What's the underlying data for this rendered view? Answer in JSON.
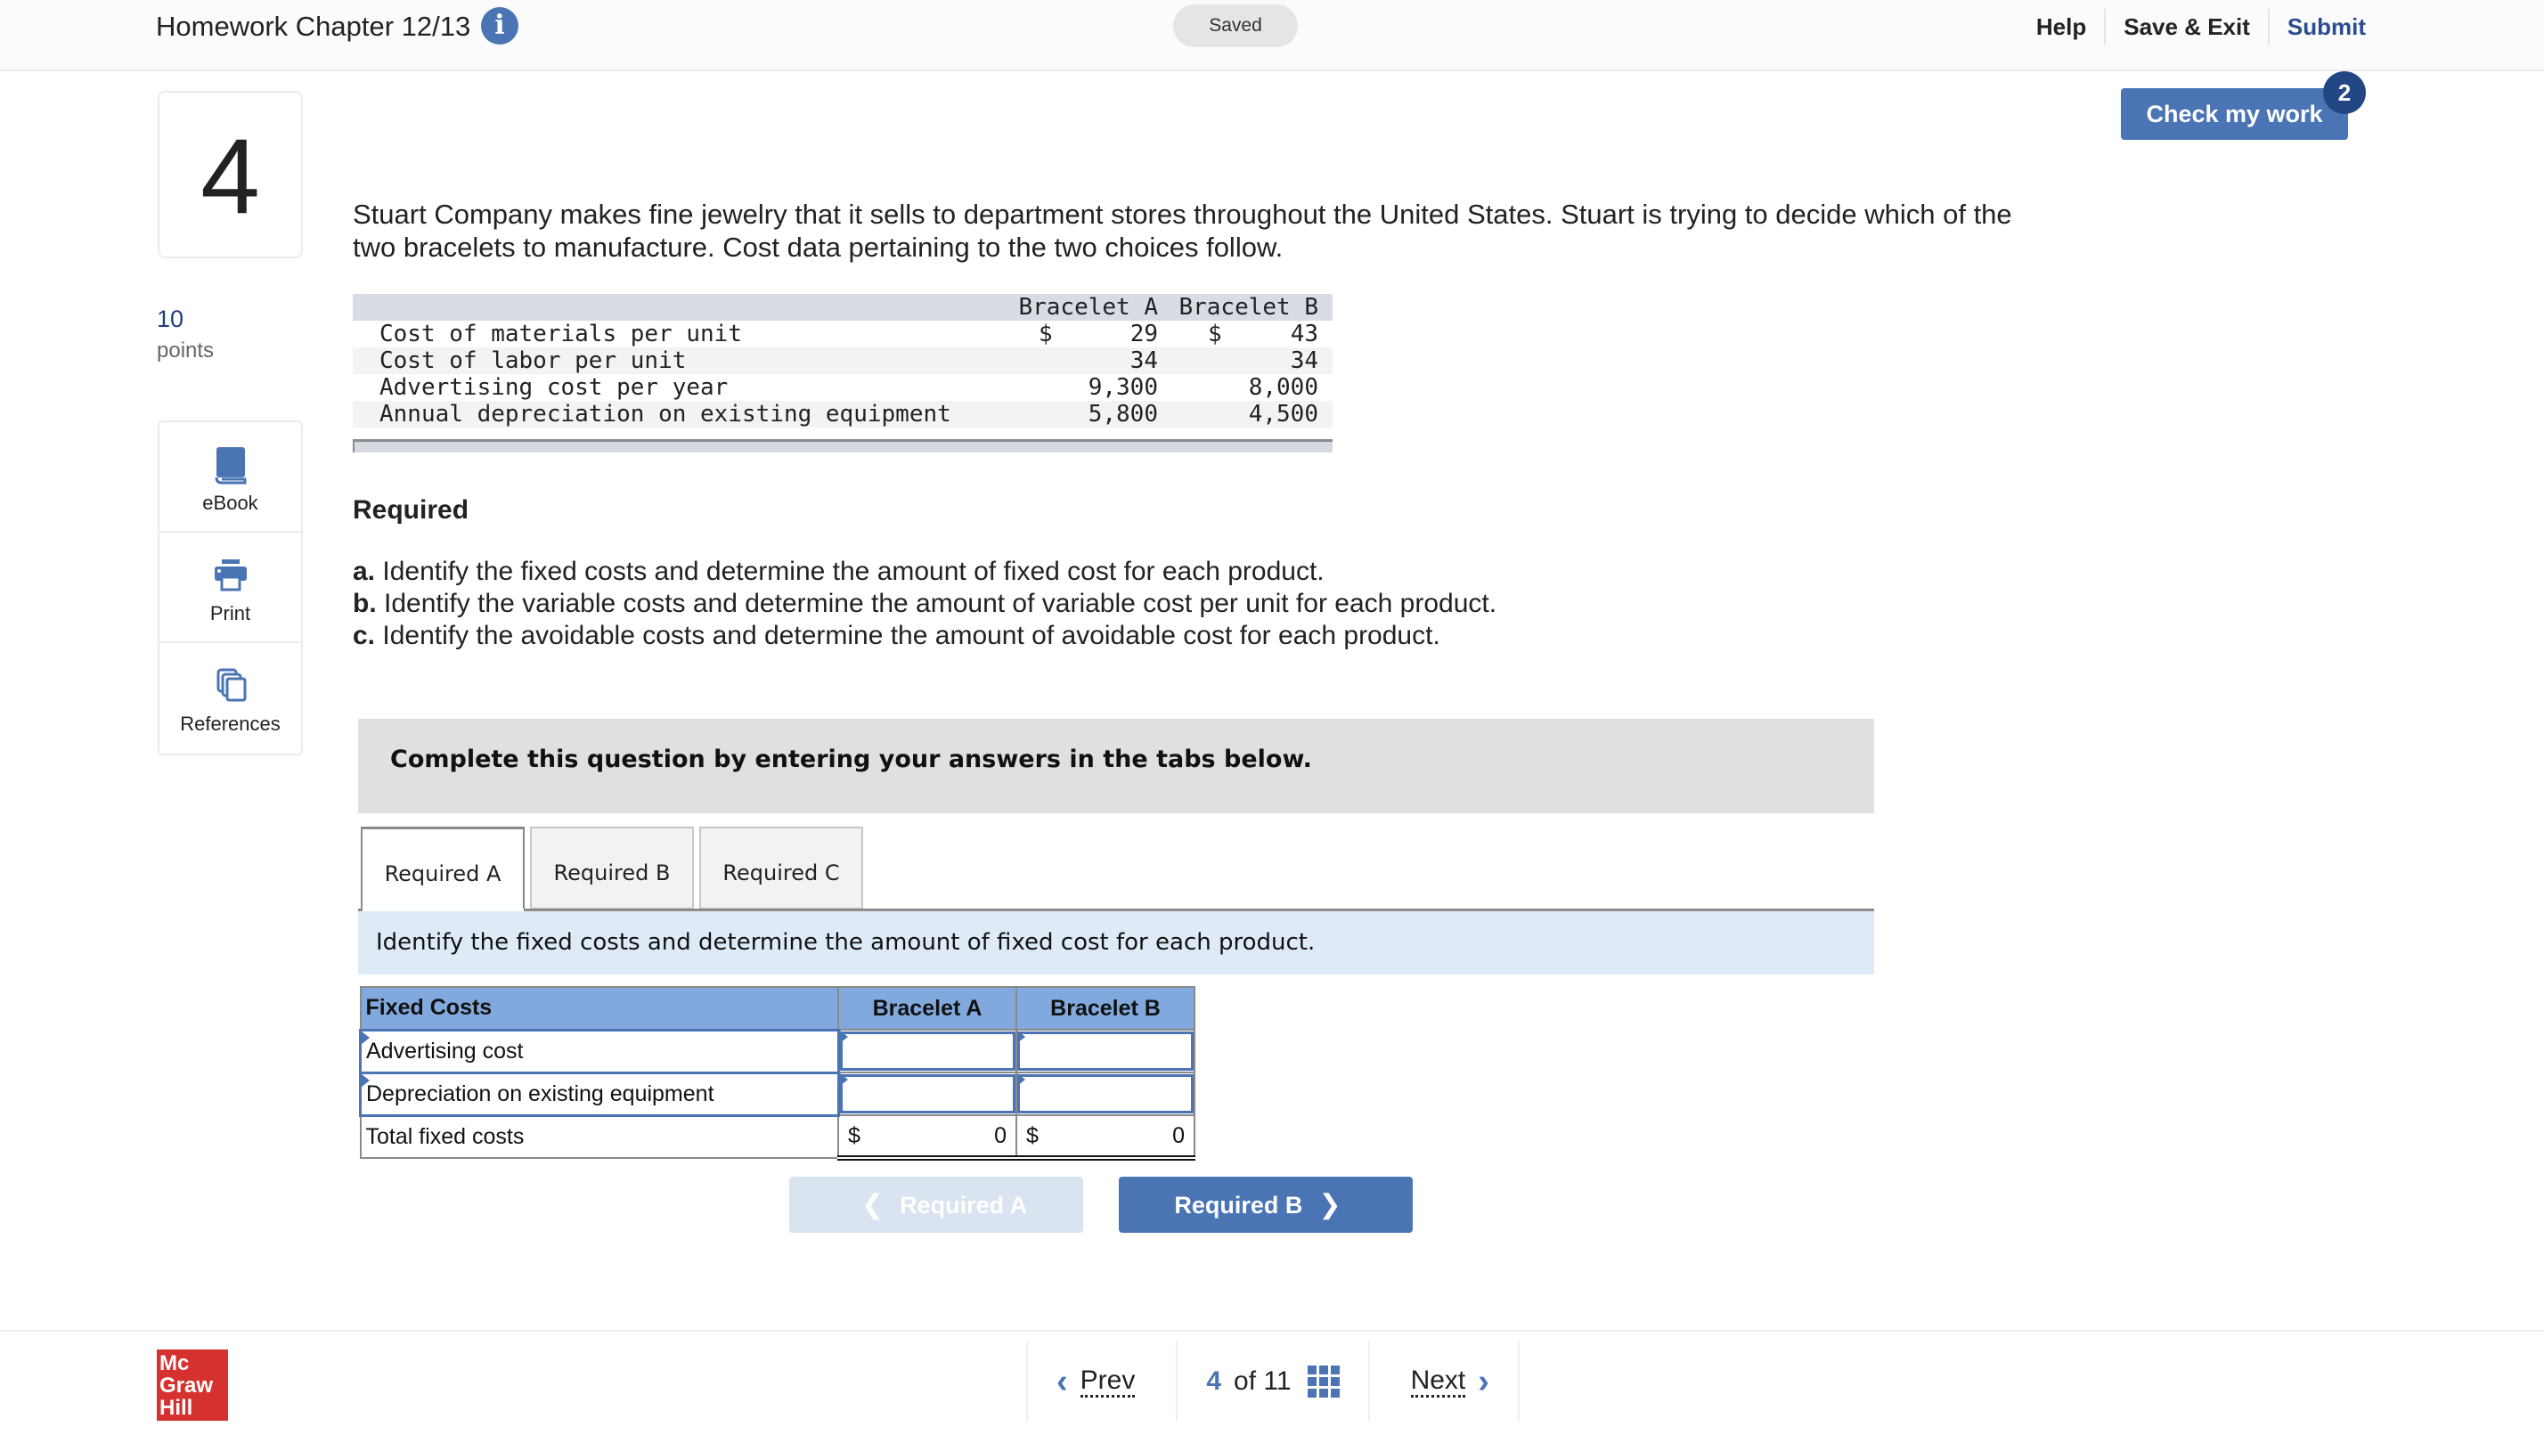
{
  "header": {
    "title": "Homework Chapter 12/13",
    "save_status": "Saved",
    "links": {
      "help": "Help",
      "save_exit": "Save & Exit",
      "submit": "Submit"
    }
  },
  "check_work": {
    "label": "Check my work",
    "badge_count": "2"
  },
  "question": {
    "number": "4",
    "points_value": "10",
    "points_label": "points",
    "text": "Stuart Company makes fine jewelry that it sells to department stores throughout the United States. Stuart is trying to decide which of the two bracelets to manufacture. Cost data pertaining to the two choices follow."
  },
  "tools": [
    {
      "label": "eBook",
      "icon": "book-icon"
    },
    {
      "label": "Print",
      "icon": "printer-icon"
    },
    {
      "label": "References",
      "icon": "copy-icon"
    }
  ],
  "cost_table": {
    "headers": [
      "",
      "Bracelet A",
      "Bracelet B"
    ],
    "rows": [
      {
        "label": "Cost of materials per unit",
        "a_cur": "$",
        "a": "29",
        "b_cur": "$",
        "b": "43"
      },
      {
        "label": "Cost of labor per unit",
        "a_cur": "",
        "a": "34",
        "b_cur": "",
        "b": "34"
      },
      {
        "label": "Advertising cost per year",
        "a_cur": "",
        "a": "9,300",
        "b_cur": "",
        "b": "8,000"
      },
      {
        "label": "Annual depreciation on existing equipment",
        "a_cur": "",
        "a": "5,800",
        "b_cur": "",
        "b": "4,500"
      }
    ]
  },
  "required": {
    "heading": "Required",
    "items": [
      {
        "letter": "a.",
        "text": "Identify the fixed costs and determine the amount of fixed cost for each product."
      },
      {
        "letter": "b.",
        "text": "Identify the variable costs and determine the amount of variable cost per unit for each product."
      },
      {
        "letter": "c.",
        "text": "Identify the avoidable costs and determine the amount of avoidable cost for each product."
      }
    ]
  },
  "complete_banner": "Complete this question by entering your answers in the tabs below.",
  "tabs": [
    {
      "label": "Required A",
      "active": true
    },
    {
      "label": "Required B",
      "active": false
    },
    {
      "label": "Required C",
      "active": false
    }
  ],
  "instruction": "Identify the fixed costs and determine the amount of fixed cost for each product.",
  "answer_table": {
    "headers": [
      "Fixed Costs",
      "Bracelet A",
      "Bracelet B"
    ],
    "rows": [
      {
        "label": "Advertising cost",
        "a": "",
        "b": ""
      },
      {
        "label": "Depreciation on existing equipment",
        "a": "",
        "b": ""
      }
    ],
    "total": {
      "label": "Total fixed costs",
      "a_cur": "$",
      "a": "0",
      "b_cur": "$",
      "b": "0"
    }
  },
  "nav_buttons": {
    "prev": "Required A",
    "next": "Required B"
  },
  "footer": {
    "logo_lines": [
      "Mc",
      "Graw",
      "Hill"
    ],
    "prev": "Prev",
    "current": "4",
    "of_label": "of",
    "total": "11",
    "next": "Next"
  }
}
